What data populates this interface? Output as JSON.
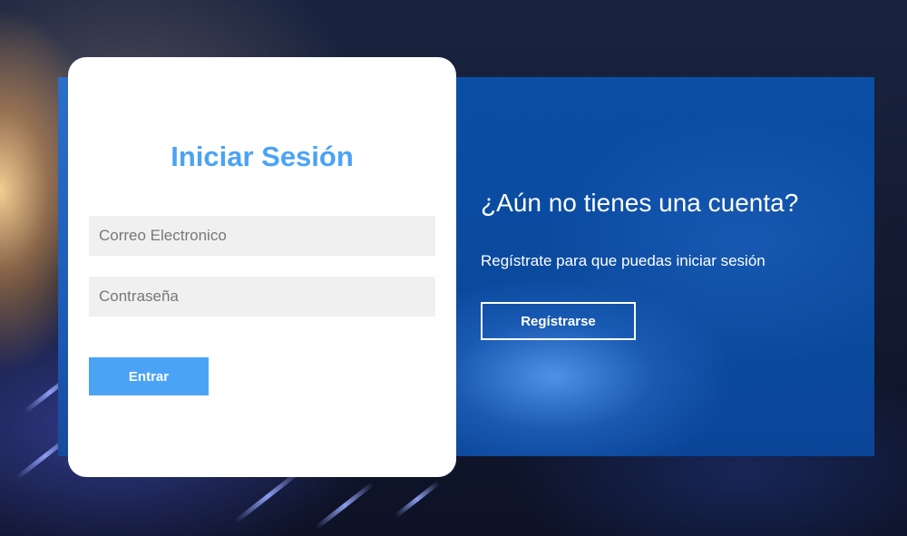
{
  "login": {
    "title": "Iniciar Sesión",
    "email_placeholder": "Correo Electronico",
    "password_placeholder": "Contraseña",
    "submit_label": "Entrar"
  },
  "register": {
    "heading": "¿Aún no tienes una cuenta?",
    "text": "Regístrate para que puedas iniciar sesión",
    "button_label": "Regístrarse"
  },
  "colors": {
    "accent": "#4ba3f5",
    "panel_blue": "#0b4ea6",
    "card_background": "#ffffff",
    "field_background": "#f0f0f0"
  }
}
